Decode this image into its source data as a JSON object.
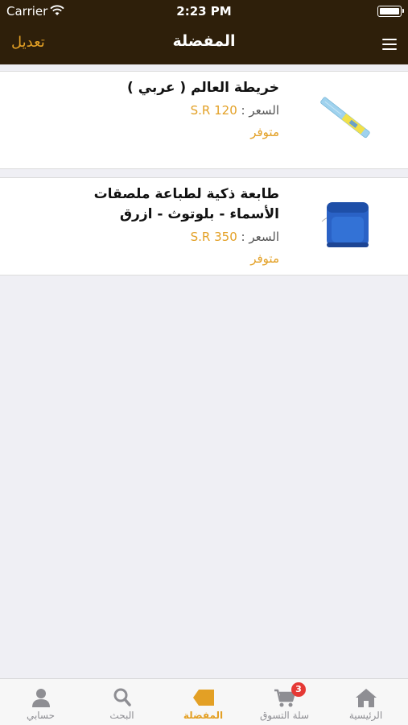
{
  "status_bar": {
    "carrier": "Carrier",
    "time": "2:23 PM"
  },
  "nav": {
    "title": "المفضلة",
    "edit_label": "تعديل",
    "menu_icon": "hamburger-menu-icon"
  },
  "colors": {
    "nav_background": "#2e1f0a",
    "accent": "#e3a025",
    "page_background": "#efeff4",
    "badge": "#e53935"
  },
  "favorites": [
    {
      "name_line1": "خريطة العالم ( عربي )",
      "price_label": "السعر :",
      "price": "S.R 120",
      "availability": "متوفر",
      "image": "world-map-tape-image"
    },
    {
      "name_line1": "طابعة ذكية لطباعة ملصقات",
      "name_line2": "الأسماء - بلوتوث - ازرق",
      "price_label": "السعر :",
      "price": "S.R 350",
      "availability": "متوفر",
      "image": "blue-label-printer-image"
    }
  ],
  "tabbar": {
    "tabs": [
      {
        "label": "حسابي",
        "icon": "person-icon"
      },
      {
        "label": "البحث",
        "icon": "search-icon"
      },
      {
        "label": "المفضلة",
        "icon": "tag-icon",
        "active": true
      },
      {
        "label": "سلة التسوق",
        "icon": "cart-icon",
        "badge": "3"
      },
      {
        "label": "الرئيسية",
        "icon": "home-icon"
      }
    ]
  }
}
